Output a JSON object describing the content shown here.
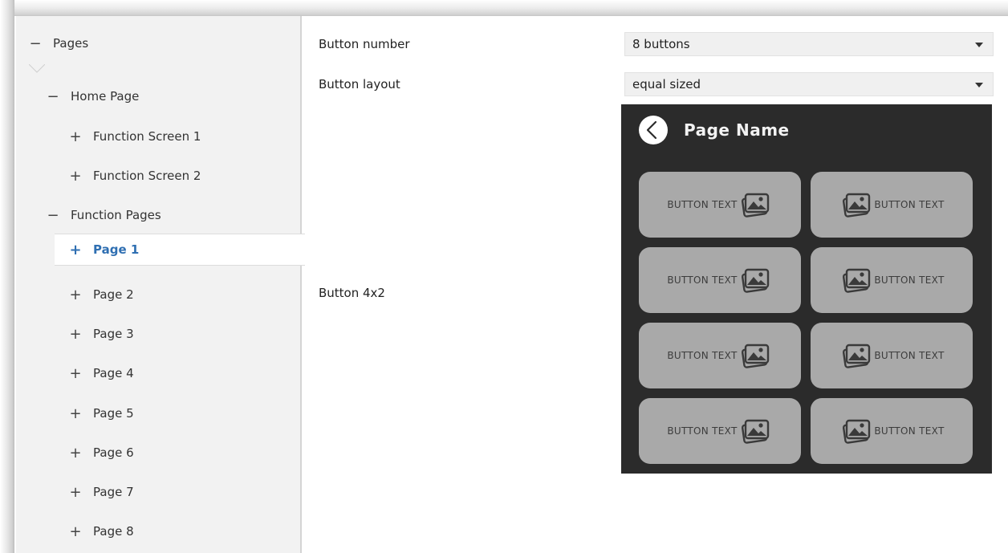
{
  "tree": {
    "items": [
      {
        "label": "Pages",
        "sign": "−"
      },
      {
        "label": "Home Page",
        "sign": "−"
      },
      {
        "label": "Function Screen 1",
        "sign": "+"
      },
      {
        "label": "Function Screen 2",
        "sign": "+"
      },
      {
        "label": "Function Pages",
        "sign": "−"
      },
      {
        "label": "Page 1",
        "sign": "+"
      },
      {
        "label": "Page 2",
        "sign": "+"
      },
      {
        "label": "Page 3",
        "sign": "+"
      },
      {
        "label": "Page 4",
        "sign": "+"
      },
      {
        "label": "Page 5",
        "sign": "+"
      },
      {
        "label": "Page 6",
        "sign": "+"
      },
      {
        "label": "Page 7",
        "sign": "+"
      },
      {
        "label": "Page 8",
        "sign": "+"
      }
    ],
    "active_item": "Page 1"
  },
  "params": {
    "button_number": {
      "label": "Button number",
      "value": "8 buttons"
    },
    "button_layout": {
      "label": "Button layout",
      "value": "equal sized"
    },
    "preview_caption": "Button 4x2"
  },
  "preview": {
    "page_title": "Page Name",
    "back_icon": "chevron-left-circle-icon",
    "button_icon": "image-icon",
    "buttons": [
      {
        "text": "BUTTON TEXT"
      },
      {
        "text": "BUTTON TEXT"
      },
      {
        "text": "BUTTON TEXT"
      },
      {
        "text": "BUTTON TEXT"
      },
      {
        "text": "BUTTON TEXT"
      },
      {
        "text": "BUTTON TEXT"
      },
      {
        "text": "BUTTON TEXT"
      },
      {
        "text": "BUTTON TEXT"
      }
    ]
  },
  "colors": {
    "active_item": "#2f6fb2",
    "tree_background": "#f2f2f2",
    "preview_background": "#2b2b2b",
    "preview_button": "#a9a9a9"
  }
}
